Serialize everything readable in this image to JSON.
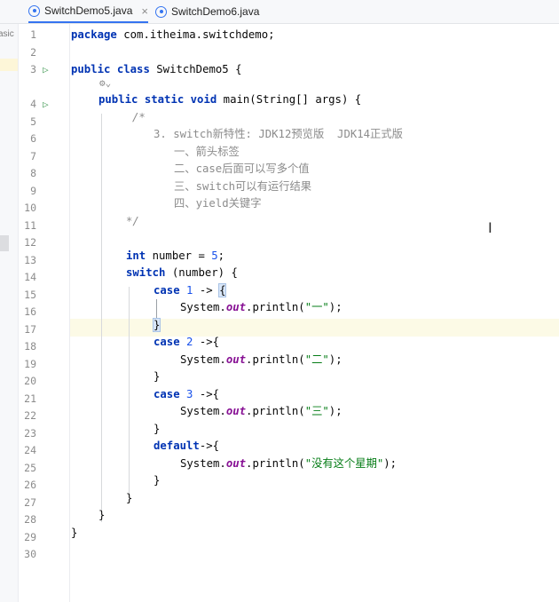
{
  "tabs": [
    {
      "label": "SwitchDemo5.java",
      "close": "×"
    },
    {
      "label": "SwitchDemo6.java"
    }
  ],
  "left_strip": {
    "label": "asic"
  },
  "lens_icon": "⚙⌄",
  "gutter": {
    "line_numbers": [
      "1",
      "2",
      "3",
      "4",
      "5",
      "6",
      "7",
      "8",
      "9",
      "10",
      "11",
      "12",
      "13",
      "14",
      "15",
      "16",
      "17",
      "18",
      "19",
      "20",
      "21",
      "22",
      "23",
      "24",
      "25",
      "26",
      "27",
      "28",
      "29",
      "30"
    ],
    "run_marker": "▷"
  },
  "code": {
    "l1_package": "package",
    "l1_rest": " com.itheima.switchdemo;",
    "l3_public": "public",
    "l3_class": "class",
    "l3_rest": " SwitchDemo5 {",
    "l4_public": "public",
    "l4_static": "static",
    "l4_void": "void",
    "l4_rest": " main(String[] args) {",
    "l5": "/*",
    "l6": "3. switch新特性: JDK12预览版  JDK14正式版",
    "l7": "一、箭头标签",
    "l8": "二、case后面可以写多个值",
    "l9": "三、switch可以有运行结果",
    "l10": "四、yield关键字",
    "l11": "*/",
    "l13_int": "int",
    "l13_rest": " number = ",
    "l13_num": "5",
    "l13_end": ";",
    "l14_switch": "switch",
    "l14_rest": " (number) {",
    "case_kw": "case",
    "l15_num": "1",
    "l15_arrow": " -> ",
    "open_brace": "{",
    "close_brace": "}",
    "println_pre": "System.",
    "println_out": "out",
    "println_mid": ".println(",
    "println_end": ");",
    "l16_str": "\"一\"",
    "l18_num": "2",
    "arrow_brace": " ->{",
    "l19_str": "\"二\"",
    "l21_num": "3",
    "l22_str": "\"三\"",
    "default_kw": "default",
    "default_rest": "->{",
    "l25_str": "\"没有这个星期\""
  },
  "text_cursor": "I"
}
